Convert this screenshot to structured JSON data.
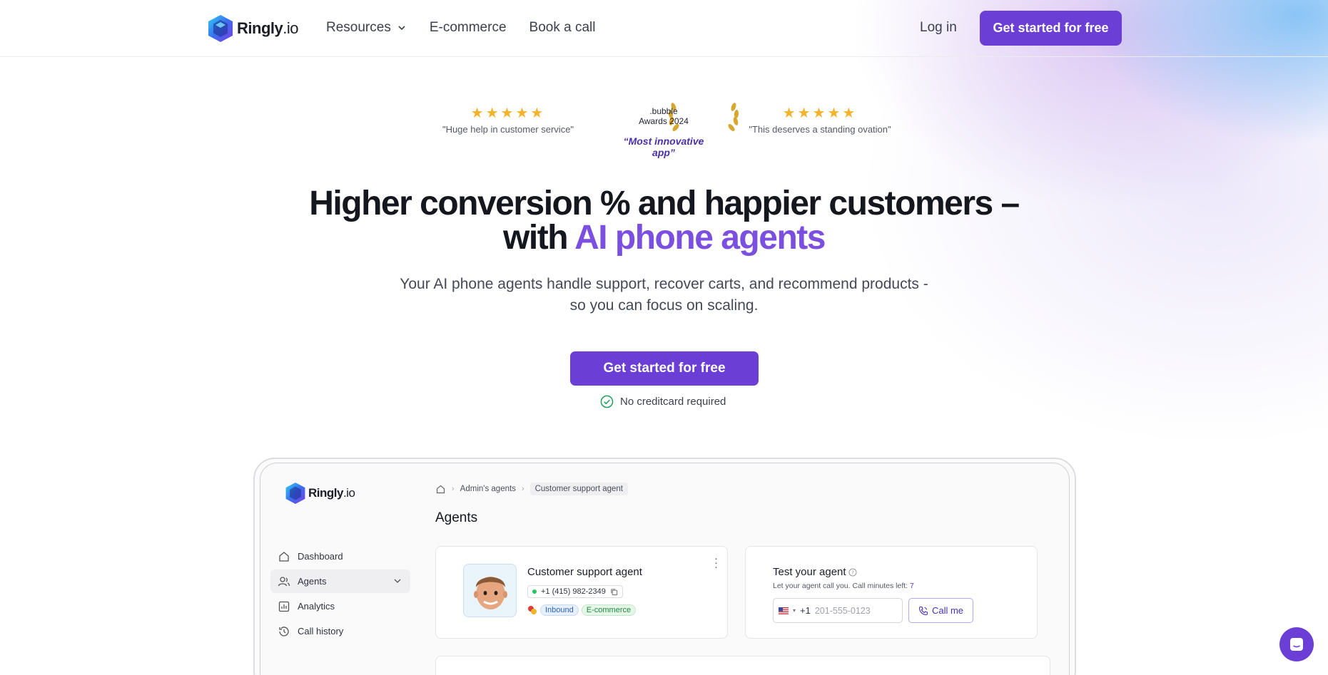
{
  "colors": {
    "accent": "#6b3fd6",
    "accent_text": "#7b4fe0",
    "star": "#f5b32b"
  },
  "nav": {
    "logo_main": "Ringly",
    "logo_tld": ".io",
    "resources": "Resources",
    "ecommerce": "E-commerce",
    "book_call": "Book a call",
    "login": "Log in",
    "cta": "Get started for free"
  },
  "reviews": {
    "left": {
      "stars": "★★★★★",
      "quote": "\"Huge help in customer service\""
    },
    "award": {
      "line1": ".bubble",
      "line2": "Awards 2024",
      "sub": "“Most innovative app”"
    },
    "right": {
      "stars": "★★★★★",
      "quote": "\"This deserves a standing ovation\""
    }
  },
  "hero": {
    "headline_1": "Higher conversion % and happier customers –",
    "headline_2a": "with ",
    "headline_2b": "AI phone agents",
    "sub_1": "Your AI phone agents handle support, recover carts, and recommend products -",
    "sub_2": "so you can focus on scaling.",
    "cta": "Get started for free",
    "note": "No creditcard required"
  },
  "app": {
    "logo_main": "Ringly",
    "logo_tld": ".io",
    "sidebar": [
      {
        "label": "Dashboard",
        "icon": "home-icon"
      },
      {
        "label": "Agents",
        "icon": "users-icon"
      },
      {
        "label": "Analytics",
        "icon": "chart-icon"
      },
      {
        "label": "Call history",
        "icon": "clock-icon"
      }
    ],
    "breadcrumb": {
      "parent": "Admin's agents",
      "current": "Customer support agent"
    },
    "page_title": "Agents",
    "agent": {
      "name": "Customer support agent",
      "phone": "+1 (415) 982-2349",
      "tags": [
        "Inbound",
        "E-commerce"
      ]
    },
    "test": {
      "title": "Test your agent",
      "sub": "Let your agent call you. Call minutes left: ",
      "minutes": "7",
      "country_code": "+1",
      "placeholder": "201-555-0123",
      "call_button": "Call me"
    }
  }
}
